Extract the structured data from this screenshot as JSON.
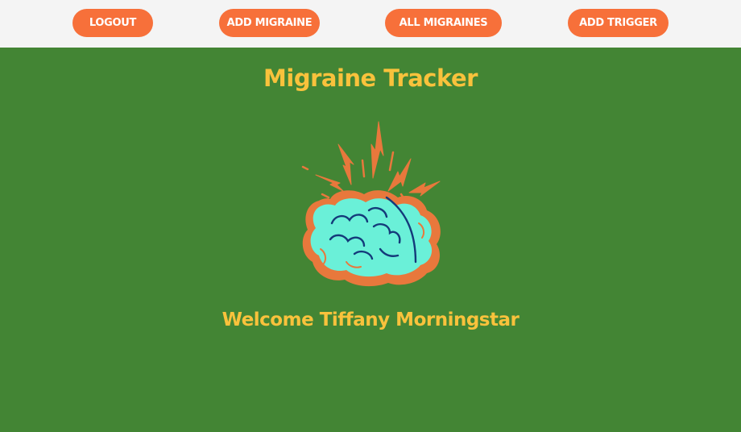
{
  "nav": {
    "logout_label": "LOGOUT",
    "add_migraine_label": "ADD MIGRAINE",
    "all_migraines_label": "ALL MIGRAINES",
    "add_trigger_label": "ADD TRIGGER"
  },
  "main": {
    "title": "Migraine Tracker",
    "welcome_prefix": "Welcome",
    "user_name": "Tiffany Morningstar",
    "logo_icon": "migraine-brain-icon"
  },
  "colors": {
    "navbar_bg": "#f4f4f4",
    "button_bg": "#f7703a",
    "button_text": "#ffffff",
    "main_bg": "#438534",
    "heading_text": "#f9c23c",
    "brain_fill": "#6af0d8",
    "brain_outline": "#e8783c",
    "brain_lines": "#143a7a"
  }
}
